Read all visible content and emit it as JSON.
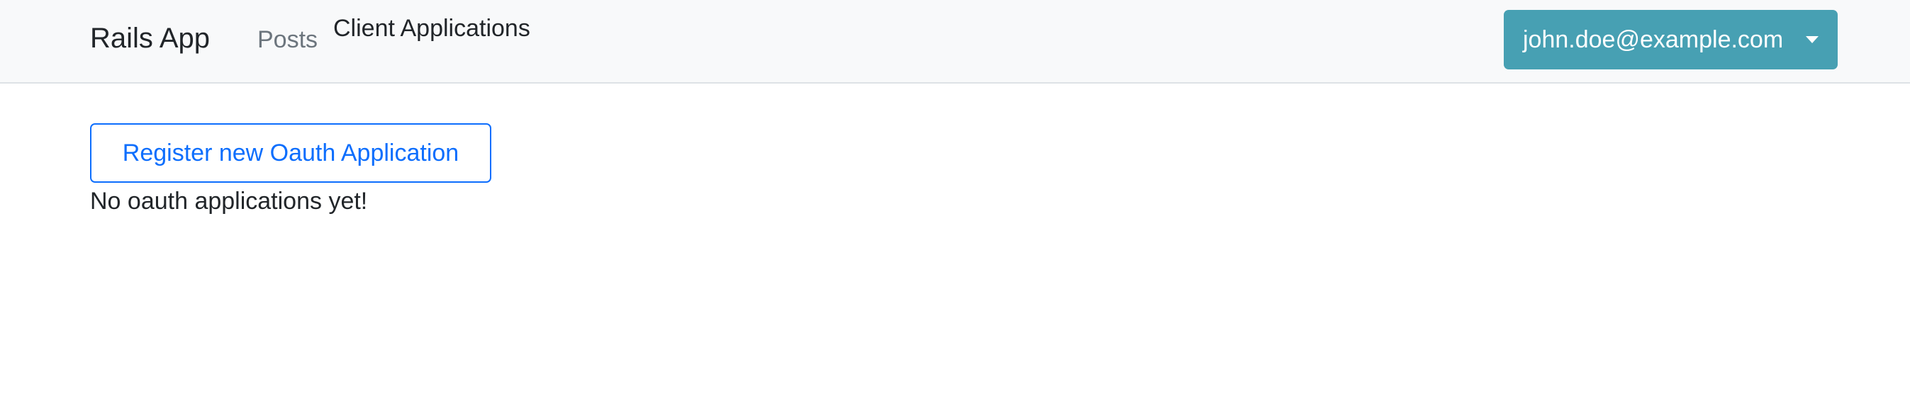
{
  "navbar": {
    "brand": "Rails App",
    "links": [
      {
        "label": "Posts"
      },
      {
        "label": "Client Applications"
      }
    ],
    "user_menu": {
      "label": "john.doe@example.com",
      "icon": "caret-down-icon"
    }
  },
  "main": {
    "register_button_label": "Register new Oauth Application",
    "empty_message": "No oauth applications yet!"
  },
  "colors": {
    "navbar_bg": "#f8f9fa",
    "user_menu_bg": "#47a0b3",
    "primary": "#0d6efd",
    "muted_link": "#6c757d"
  }
}
